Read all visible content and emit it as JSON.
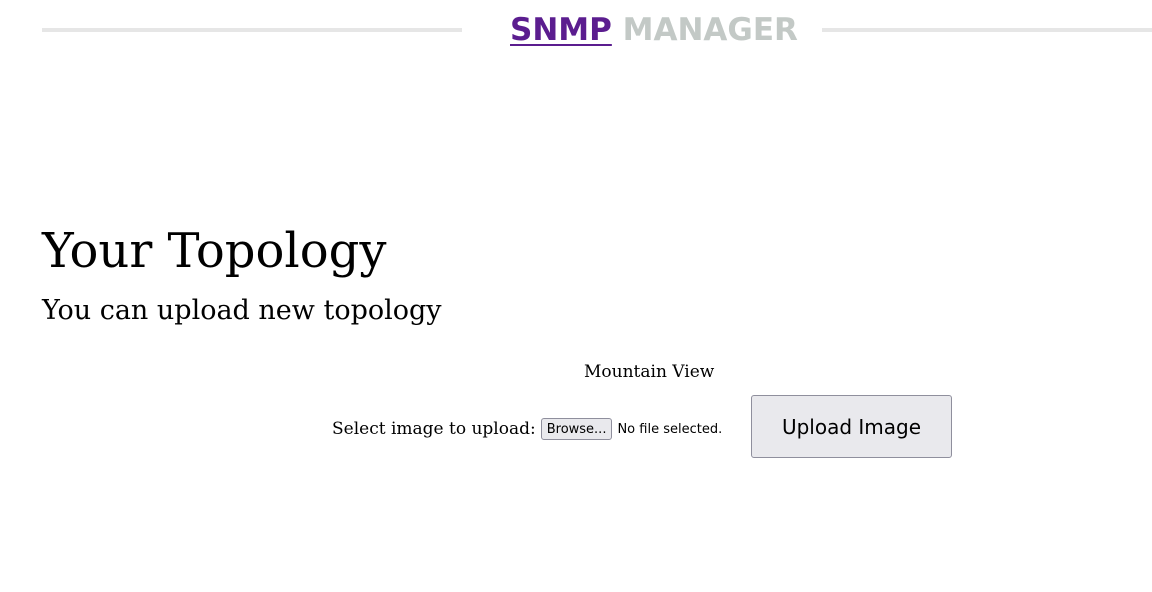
{
  "header": {
    "brand_primary": "SNMP",
    "brand_secondary": "MANAGER"
  },
  "colors": {
    "brand_primary": "#5b1d8f",
    "brand_secondary": "#c3c9c6",
    "header_rule": "#e6e6e6",
    "button_bg": "#e9e9ed"
  },
  "main": {
    "title": "Your Topology",
    "subtitle": "You can upload new topology",
    "location": "Mountain View"
  },
  "upload": {
    "label": "Select image to upload:",
    "browse_label": "Browse...",
    "file_status": "No file selected.",
    "submit_label": "Upload Image"
  }
}
